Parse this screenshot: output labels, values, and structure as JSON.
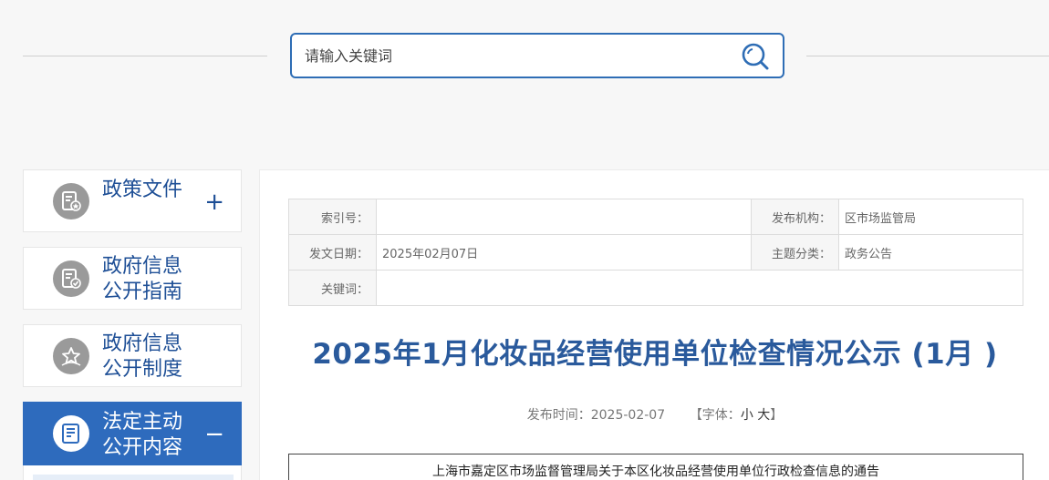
{
  "search": {
    "placeholder": "请输入关键词"
  },
  "sidebar": {
    "items": [
      {
        "label": "政策文件",
        "toggle": "+"
      },
      {
        "label": "政府信息\n公开指南"
      },
      {
        "label": "政府信息\n公开制度"
      },
      {
        "label": "法定主动\n公开内容",
        "toggle": "−"
      }
    ]
  },
  "meta": {
    "index_no_label": "索引号：",
    "index_no_value": "",
    "publisher_label": "发布机构：",
    "publisher_value": "区市场监管局",
    "date_label": "发文日期：",
    "date_value": "2025年02月07日",
    "category_label": "主题分类：",
    "category_value": "政务公告",
    "keywords_label": "关键词：",
    "keywords_value": ""
  },
  "article": {
    "title": "2025年1月化妆品经营使用单位检查情况公示 (1月 )",
    "publish_time_label": "发布时间：2025-02-07",
    "font_size_prefix": "【字体：",
    "font_small": "小",
    "font_large": "大",
    "font_size_suffix": "】",
    "notice_heading": "上海市嘉定区市场监督管理局关于本区化妆品经营使用单位行政检查信息的通告"
  },
  "colors": {
    "accent": "#2e6bbd",
    "title": "#2a5a9c",
    "search_border": "#2e6db5"
  }
}
